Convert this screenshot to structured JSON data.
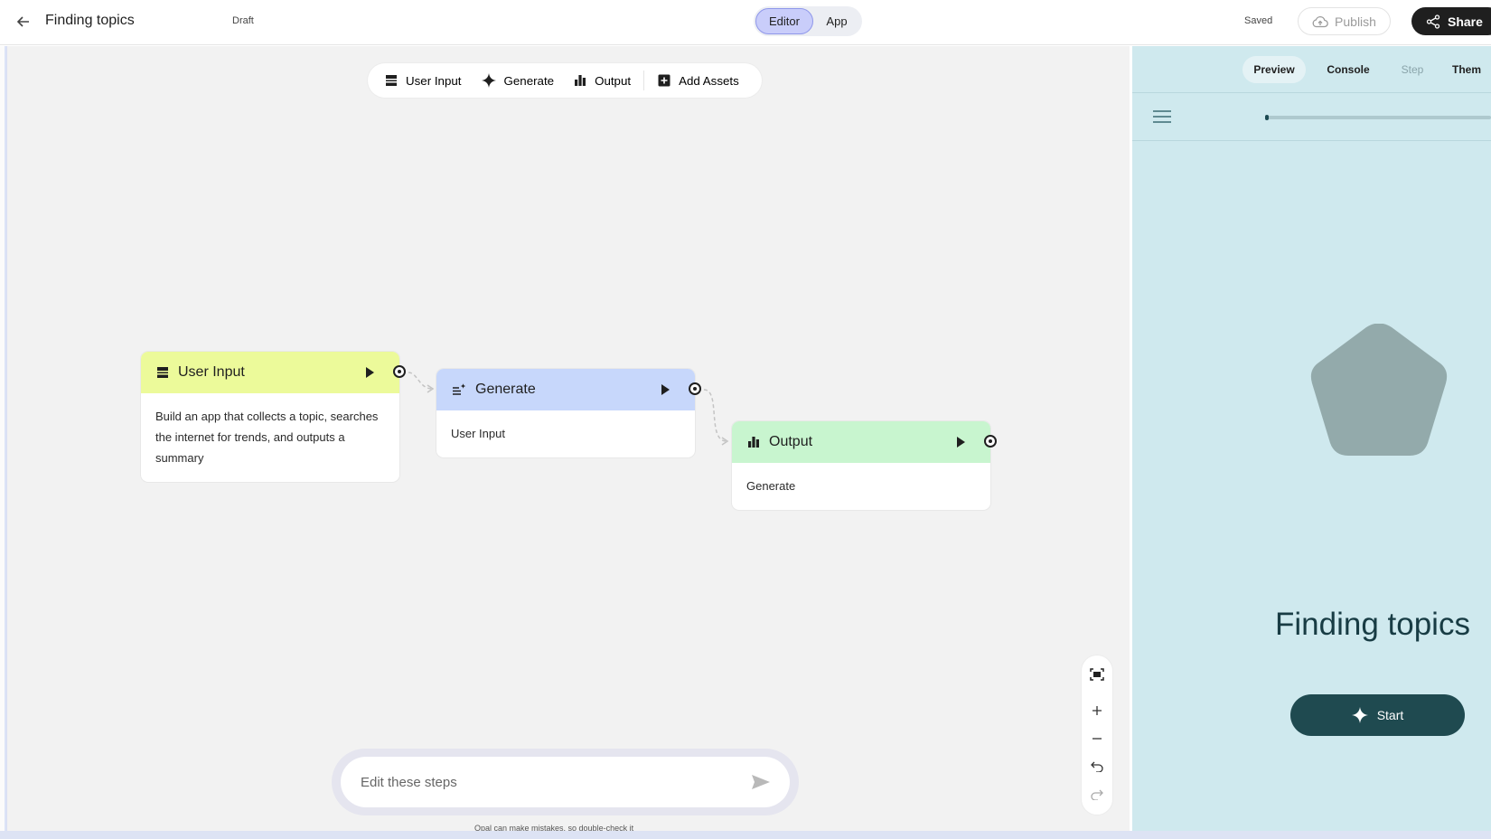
{
  "header": {
    "title": "Finding topics",
    "status": "Draft",
    "tabs": {
      "editor": "Editor",
      "app": "App"
    },
    "saved": "Saved",
    "publish_label": "Publish",
    "share_label": "Share"
  },
  "toolbar": {
    "user_input": "User Input",
    "generate": "Generate",
    "output": "Output",
    "add_assets": "Add Assets"
  },
  "nodes": {
    "user_input": {
      "title": "User Input",
      "body": "Build an app that collects a topic, searches the internet for trends, and outputs a summary",
      "color": "#ecfa9a"
    },
    "generate": {
      "title": "Generate",
      "body": "User Input",
      "color": "#c7d7fb"
    },
    "output": {
      "title": "Output",
      "body": "Generate",
      "color": "#c8f5cf"
    }
  },
  "prompt": {
    "placeholder": "Edit these steps",
    "disclaimer": "Opal can make mistakes, so double-check it"
  },
  "panel": {
    "tabs": {
      "preview": "Preview",
      "console": "Console",
      "step": "Step",
      "theme": "Them"
    },
    "app_title": "Finding topics",
    "start_label": "Start",
    "progress": 0.0
  },
  "colors": {
    "accent_editor": "#c9cdfa",
    "panel_bg": "#cfe9ee",
    "start_button": "#1f4a50",
    "pentagon": "#93aaab"
  }
}
